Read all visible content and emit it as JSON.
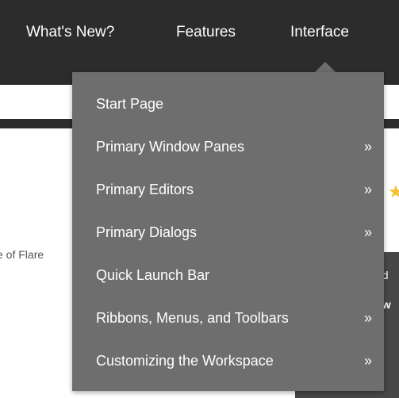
{
  "nav": {
    "items": [
      "What's New?",
      "Features",
      "Interface"
    ]
  },
  "background": {
    "left_text": "e of Flare",
    "right_text_1": "ed",
    "right_text_2": "ew"
  },
  "dropdown": {
    "items": [
      {
        "label": "Start Page",
        "arrow": ""
      },
      {
        "label": "Primary Window Panes",
        "arrow": "»"
      },
      {
        "label": "Primary Editors",
        "arrow": "»"
      },
      {
        "label": "Primary Dialogs",
        "arrow": "»"
      },
      {
        "label": "Quick Launch Bar",
        "arrow": ""
      },
      {
        "label": "Ribbons, Menus, and Toolbars",
        "arrow": "»"
      },
      {
        "label": "Customizing the Workspace",
        "arrow": "»"
      }
    ]
  },
  "colors": {
    "nav_bg": "#2c2c2c",
    "dropdown_bg": "#6e6e6e",
    "text": "#ffffff"
  },
  "icons": {
    "star": "star-icon",
    "submenu": "double-chevron-right-icon"
  }
}
